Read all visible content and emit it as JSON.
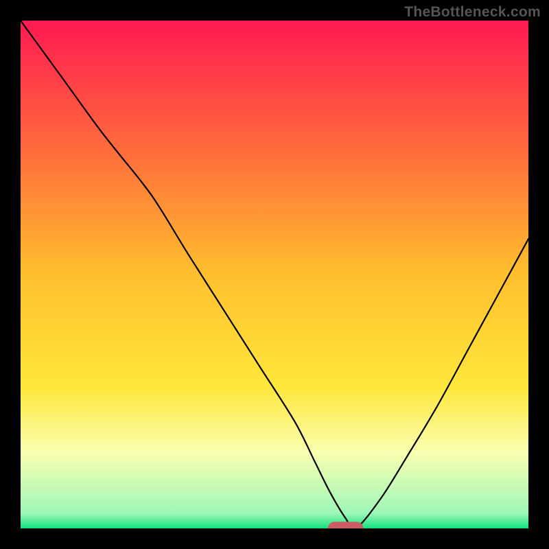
{
  "watermark": "TheBottleneck.com",
  "chart_data": {
    "type": "line",
    "title": "",
    "xlabel": "",
    "ylabel": "",
    "xlim": [
      0,
      100
    ],
    "ylim": [
      0,
      100
    ],
    "grid": false,
    "legend": false,
    "background": {
      "type": "vertical-gradient",
      "stops": [
        {
          "pos": 0.0,
          "color": "#ff1a52"
        },
        {
          "pos": 0.25,
          "color": "#ff6a3c"
        },
        {
          "pos": 0.5,
          "color": "#ffbf2e"
        },
        {
          "pos": 0.72,
          "color": "#ffe73a"
        },
        {
          "pos": 0.85,
          "color": "#faffb0"
        },
        {
          "pos": 0.97,
          "color": "#9ef7b8"
        },
        {
          "pos": 1.0,
          "color": "#13e07e"
        }
      ]
    },
    "series": [
      {
        "name": "bottleneck-curve",
        "color": "#000000",
        "stroke_width": 2.2,
        "x": [
          0,
          8,
          16,
          24,
          27.5,
          33,
          40,
          47,
          54,
          58,
          61,
          64,
          66,
          71,
          76,
          82,
          88,
          94,
          100
        ],
        "values": [
          100,
          89,
          78,
          68,
          63,
          54,
          43,
          32,
          21,
          13,
          7,
          2,
          0,
          6,
          14,
          24,
          35,
          46,
          57
        ]
      }
    ],
    "marker": {
      "name": "optimal-point",
      "x": 64,
      "y": 0,
      "width_pct": 7,
      "height_pct": 2.6,
      "color": "#cc5c63",
      "shape": "rounded-rect"
    }
  }
}
